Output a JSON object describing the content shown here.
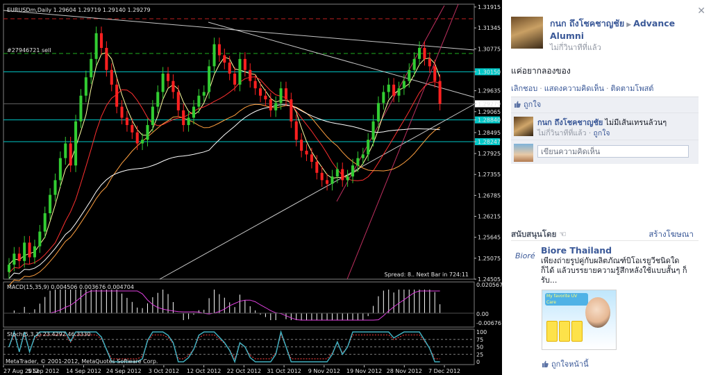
{
  "chart": {
    "title": "EURUSDm,Daily  1.29604 1.29719 1.29140 1.29279",
    "order_label": "#27946721 sell",
    "spread_text": "Spread: 8.. Next Bar in 724:11",
    "price_axis": [
      "1.31915",
      "1.31345",
      "1.30775",
      "1.30150",
      "1.29635",
      "1.29279",
      "1.29065",
      "1.28840",
      "1.28495",
      "1.28247",
      "1.27925",
      "1.27355",
      "1.26785",
      "1.26215",
      "1.25645",
      "1.25075",
      "1.24505"
    ],
    "highlighted_prices": [
      "1.30150",
      "1.28840",
      "1.28247"
    ],
    "current_price": "1.29279",
    "macd_label": "MACD(15,35,9) 0.004506 0.003676 0.004704",
    "macd_axis": [
      "0.020567",
      "0.00",
      "-0.006761"
    ],
    "stoch_label": "Stoch(5,3,3) 23.4292 46.3330",
    "stoch_axis": [
      "100",
      "75",
      "50",
      "25",
      "0"
    ],
    "copyright": "MetaTrader, © 2001-2012, MetaQuotes Software Corp.",
    "date_axis": [
      "27 Aug 2012",
      "5 Sep 2012",
      "14 Sep 2012",
      "24 Sep 2012",
      "3 Oct 2012",
      "12 Oct 2012",
      "22 Oct 2012",
      "31 Oct 2012",
      "9 Nov 2012",
      "19 Nov 2012",
      "28 Nov 2012",
      "7 Dec 2012"
    ],
    "colors": {
      "bull": "#32cd32",
      "bear": "#ff2020",
      "level": "#00c8c8",
      "ma_fast": "#ffffa0",
      "ma_mid": "#ff3030",
      "ma_slow": "#ffa040",
      "ma_long": "#ffffff",
      "trend": "#c03060",
      "macd_hist": "#ffffff",
      "macd_signal": "#e040e0",
      "stoch_main": "#40b0c0",
      "stoch_signal": "#ff4040"
    }
  },
  "chart_data": {
    "type": "candlestick",
    "symbol": "EURUSDm",
    "timeframe": "Daily",
    "ohlc_last": {
      "open": 1.29604,
      "high": 1.29719,
      "low": 1.2914,
      "close": 1.29279
    },
    "ylim": [
      1.24505,
      1.31915
    ],
    "closes": [
      1.249,
      1.252,
      1.25,
      1.255,
      1.251,
      1.254,
      1.258,
      1.263,
      1.268,
      1.272,
      1.278,
      1.282,
      1.276,
      1.288,
      1.295,
      1.3,
      1.305,
      1.312,
      1.308,
      1.302,
      1.298,
      1.292,
      1.289,
      1.287,
      1.285,
      1.282,
      1.283,
      1.287,
      1.292,
      1.296,
      1.301,
      1.299,
      1.296,
      1.291,
      1.287,
      1.289,
      1.292,
      1.295,
      1.296,
      1.303,
      1.309,
      1.306,
      1.304,
      1.301,
      1.298,
      1.305,
      1.302,
      1.299,
      1.297,
      1.295,
      1.294,
      1.291,
      1.293,
      1.297,
      1.294,
      1.288,
      1.283,
      1.28,
      1.279,
      1.277,
      1.274,
      1.272,
      1.271,
      1.273,
      1.275,
      1.272,
      1.273,
      1.276,
      1.278,
      1.279,
      1.283,
      1.288,
      1.293,
      1.296,
      1.298,
      1.295,
      1.297,
      1.299,
      1.302,
      1.305,
      1.308,
      1.305,
      1.303,
      1.299,
      1.29279
    ],
    "levels": [
      1.3015,
      1.2884,
      1.28247
    ]
  },
  "post": {
    "author": "กนก ถึงโชคชาญชัย",
    "target": "Advance Alumni",
    "time": "ไม่กี่วินาทีที่แล้ว",
    "status": "แค่อยากลองของ",
    "actions": [
      "เลิกชอบ",
      "แสดงความคิดเห็น",
      "ติดตามโพสต์"
    ],
    "likes_label": "ถูกใจ",
    "comment": {
      "author": "กนก ถึงโชคชาญชัย",
      "text": "ไม่มีเส้นเทรนล้วนๆ",
      "time": "ไม่กี่วินาทีที่แล้ว",
      "like": "ถูกใจ"
    },
    "write_placeholder": "เขียนความคิดเห็น"
  },
  "ads": {
    "header": "สนับสนุนโดย",
    "create": "สร้างโฆษณา",
    "logo_text": "Bioré",
    "title": "Biore Thailand",
    "text": "เพียงถ่ายรูปคู่กับผลิตภัณฑ์บิโอเรยูวีชนิดใดก็ได้ แล้วบรรยายความรู้สึกหลังใช้แบบสั้นๆ ก็รับ...",
    "image_caption": "My favorite UV Care",
    "like_page": "ถูกใจหน้านี้"
  }
}
